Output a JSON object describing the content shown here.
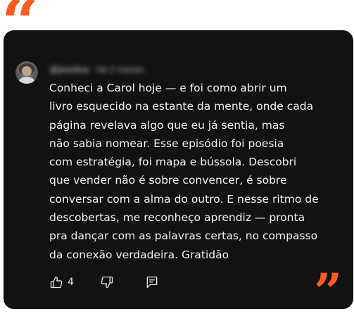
{
  "comment": {
    "author_handle": "@jessilva",
    "separator": "·",
    "posted_ago": "há 2 meses",
    "lines": [
      "Conheci a Carol hoje — e foi como abrir um",
      "livro esquecido na estante da mente, onde cada",
      "página revelava algo que eu já sentia, mas",
      "não sabia nomear. Esse episódio foi poesia",
      "com estratégia, foi mapa e bússola. Descobri",
      "que vender não é sobre convencer, é sobre",
      "conversar com a alma do outro. E nesse ritmo de",
      "descobertas, me reconheço aprendiz — pronta",
      "pra dançar com as palavras certas, no compasso",
      "da conexão verdadeira. Gratidão"
    ],
    "like_count": "4"
  },
  "decor": {
    "open_quote": "“",
    "close_quote": "”"
  },
  "icons": {
    "like": "thumbs-up-icon",
    "dislike": "thumbs-down-icon",
    "reply": "reply-comment-icon"
  },
  "colors": {
    "accent": "#ff5a1f",
    "card_background": "#121212",
    "text": "#f1f1f1",
    "meta_text": "#aaaaaa"
  }
}
